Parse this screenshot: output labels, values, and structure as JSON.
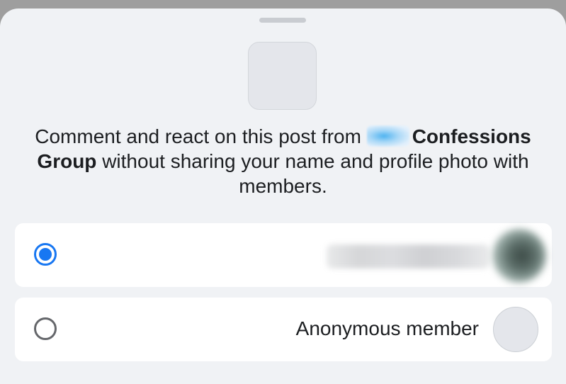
{
  "sheet": {
    "description_before": "Comment and react on this post from",
    "group_name_part1": "Confessions",
    "group_name_part2": "Group",
    "description_after": "without sharing your name and profile photo with members."
  },
  "options": [
    {
      "id": "own-profile",
      "label": "",
      "selected": true
    },
    {
      "id": "anonymous",
      "label": "Anonymous member",
      "selected": false
    }
  ],
  "colors": {
    "accent": "#1877f2",
    "sheet_background": "#f0f2f5",
    "card_background": "#ffffff",
    "text": "#1c1e21"
  }
}
